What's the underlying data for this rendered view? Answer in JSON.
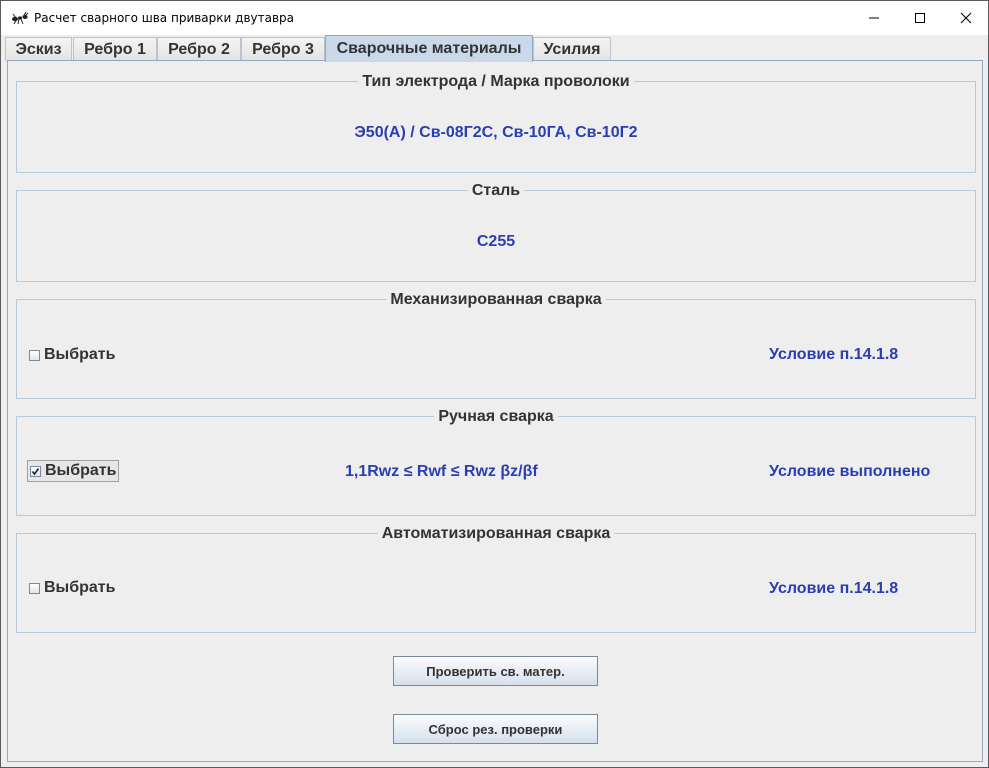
{
  "window": {
    "title": "Расчет сварного шва приварки двутавра",
    "app_icon": "ant-icon"
  },
  "tabs": [
    {
      "label": "Эскиз",
      "active": false
    },
    {
      "label": "Ребро 1",
      "active": false
    },
    {
      "label": "Ребро 2",
      "active": false
    },
    {
      "label": "Ребро 3",
      "active": false
    },
    {
      "label": "Сварочные материалы",
      "active": true
    },
    {
      "label": "Усилия",
      "active": false
    }
  ],
  "electrode_group": {
    "title": "Тип электрода / Марка проволоки",
    "value": "Э50(А) / Св-08Г2С, Св-10ГА, Св-10Г2"
  },
  "steel_group": {
    "title": "Сталь",
    "value": "С255"
  },
  "mechanized_group": {
    "title": "Механизированная сварка",
    "checkbox_label": "Выбрать",
    "checked": false,
    "status": "Условие п.14.1.8"
  },
  "manual_group": {
    "title": "Ручная сварка",
    "checkbox_label": "Выбрать",
    "checked": true,
    "formula": "1,1Rwz ≤ Rwf ≤ Rwz βz/βf",
    "status": "Условие выполнено"
  },
  "automated_group": {
    "title": "Автоматизированная сварка",
    "checkbox_label": "Выбрать",
    "checked": false,
    "status": "Условие п.14.1.8"
  },
  "buttons": {
    "check_materials": "Проверить св. матер.",
    "reset_check": "Сброс рез. проверки"
  },
  "colors": {
    "value_text": "#2a3eb1",
    "label_text": "#333333",
    "background": "#eeeeee"
  }
}
